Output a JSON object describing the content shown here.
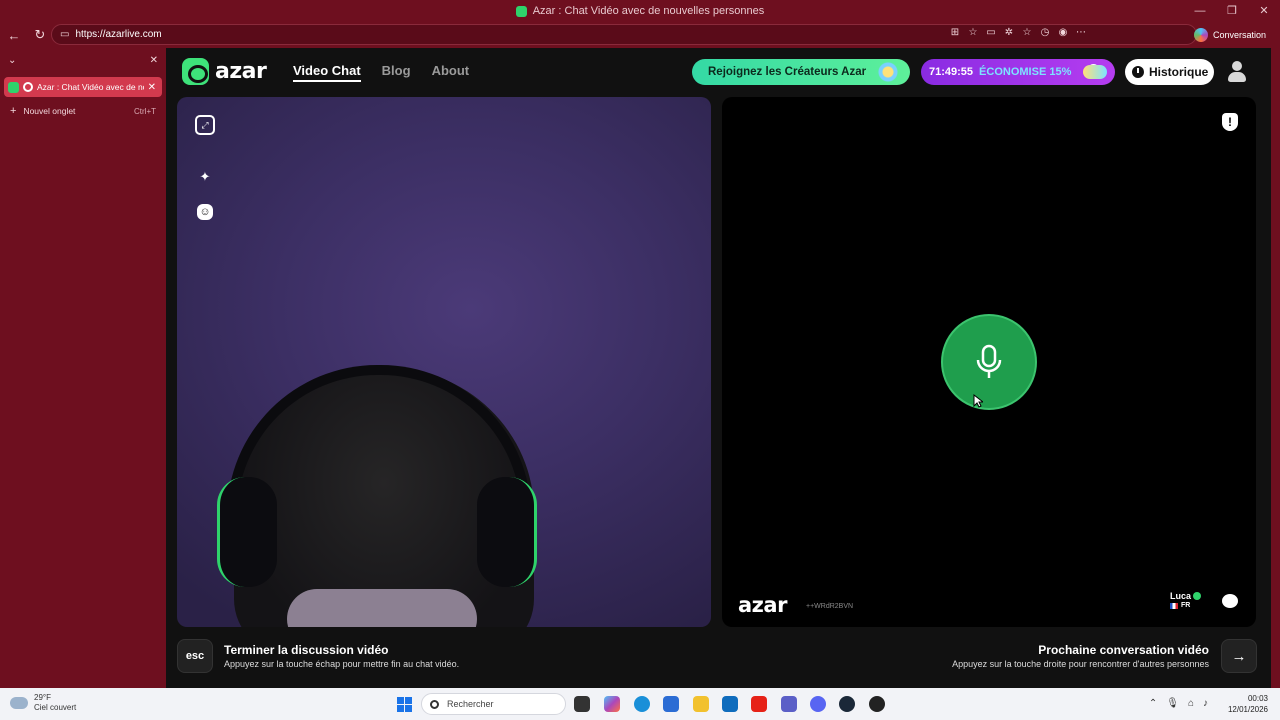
{
  "window": {
    "title": "Azar : Chat Vidéo avec de nouvelles personnes"
  },
  "browser": {
    "url": "https://azarlive.com",
    "profile_button": "Conversation"
  },
  "tabs": {
    "active_title": "Azar : Chat Vidéo avec de nouvelles personnes",
    "new_tab_label": "Nouvel onglet",
    "new_tab_shortcut": "Ctrl+T"
  },
  "azar": {
    "logo_text": "azar",
    "nav": {
      "video_chat": "Video Chat",
      "blog": "Blog",
      "about": "About"
    },
    "creators_banner": "Rejoignez les Créateurs Azar",
    "promo": {
      "timer": "71:49:55",
      "discount": "ÉCONOMISE 15%"
    },
    "history_button": "Historique",
    "remote": {
      "logo_text": "azar",
      "code": "++WRdR2BVN",
      "user_name": "Luca",
      "user_country": "FR"
    },
    "bottom": {
      "esc_key": "esc",
      "end_title": "Terminer la discussion vidéo",
      "end_desc": "Appuyez sur la touche échap pour mettre fin au chat vidéo.",
      "next_title": "Prochaine conversation vidéo",
      "next_desc": "Appuyez sur la touche droite pour rencontrer d'autres personnes",
      "next_key": "→"
    }
  },
  "taskbar": {
    "weather_temp": "29°F",
    "weather_desc": "Ciel couvert",
    "search_placeholder": "Rechercher",
    "time": "00:03",
    "date": "12/01/2026"
  },
  "colors": {
    "browser_theme": "#6e0f1f",
    "azar_green": "#3ee27a",
    "mic_green": "#1f9e4d",
    "promo_purple": "#9b35e8"
  }
}
